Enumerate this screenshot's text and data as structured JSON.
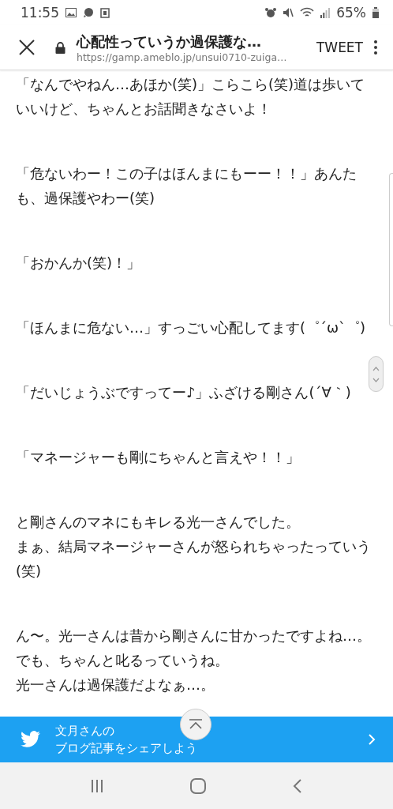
{
  "status_bar": {
    "time": "11:55",
    "battery": "65%"
  },
  "header": {
    "title": "心配性っていうか過保護な…",
    "url": "https://gamp.ameblo.jp/unsui0710-zuiga…",
    "action": "TWEET"
  },
  "paragraphs": [
    {
      "lines": [
        "「なんでやねん…あほか(笑)」こらこら(笑)道は歩いていいけど、ちゃんとお話聞きなさいよ！"
      ]
    },
    {
      "lines": [
        "「危ないわー！この子はほんまにもーー！！」あんたも、過保護やわー(笑)"
      ]
    },
    {
      "lines": [
        "「おかんか(笑)！」"
      ]
    },
    {
      "lines": [
        "「ほんまに危ない…」すっごい心配してます(゜´ω`゜)"
      ]
    },
    {
      "lines": [
        "「だいじょうぶですってー♪」ふざける剛さん(´∀｀)"
      ]
    },
    {
      "lines": [
        "「マネージャーも剛にちゃんと言えや！！」"
      ]
    },
    {
      "lines": [
        "と剛さんのマネにもキレる光一さんでした。",
        "まぁ、結局マネージャーさんが怒られちゃったっていう(笑)"
      ]
    },
    {
      "lines": [
        "ん〜。光一さんは昔から剛さんに甘かったですよね…。",
        "でも、ちゃんと叱るっていうね。",
        "光一さんは過保護だよなぁ…。"
      ]
    }
  ],
  "share_banner": {
    "lines": [
      "文月さんの",
      "ブログ記事をシェアしよう"
    ]
  }
}
